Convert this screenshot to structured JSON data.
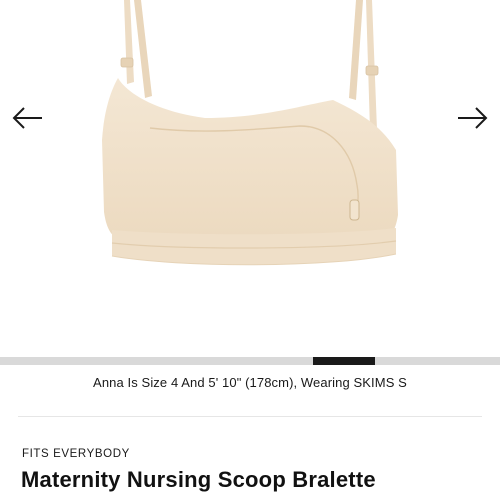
{
  "gallery": {
    "image_subject": "Maternity Nursing Scoop Bralette in sand",
    "prev_icon": "arrow-left-icon",
    "next_icon": "arrow-right-icon",
    "progress_fraction": 0.125,
    "progress_position": 0.625
  },
  "caption": "Anna Is Size 4 And 5' 10\" (178cm), Wearing SKIMS S",
  "product": {
    "eyebrow": "FITS EVERYBODY",
    "title": "Maternity Nursing Scoop Bralette"
  },
  "colors": {
    "fabric": "#f1e2cd",
    "fabric_shadow": "#e4d0b4",
    "progress_active": "#1a1a1a",
    "progress_track": "#d9d9d9"
  }
}
